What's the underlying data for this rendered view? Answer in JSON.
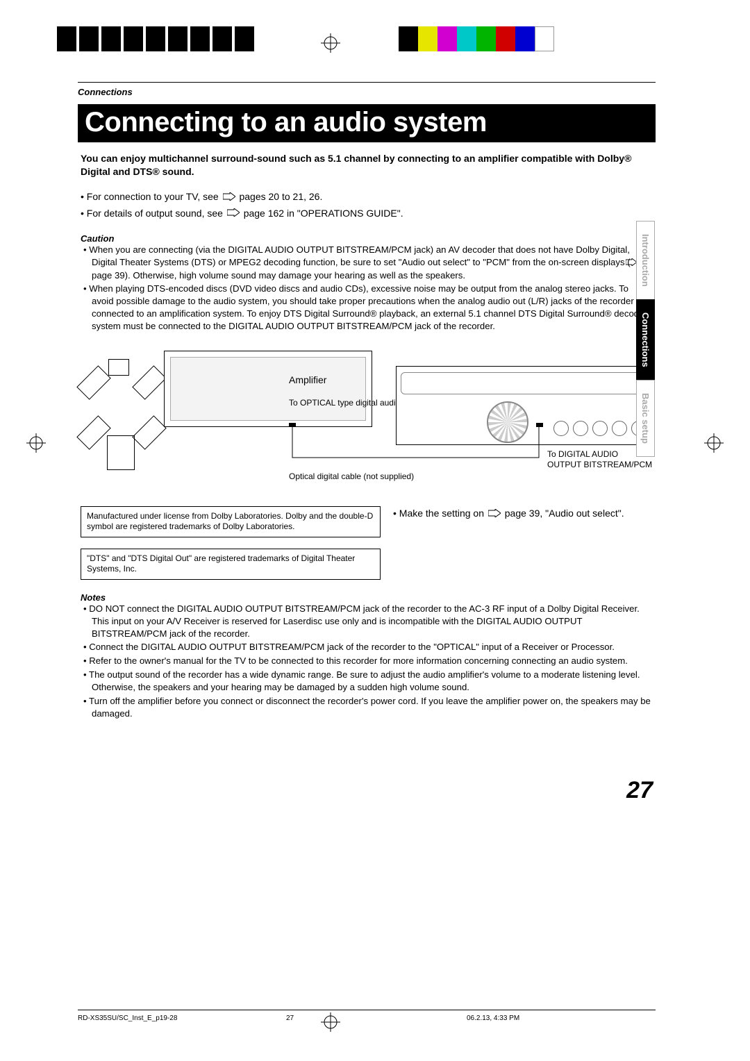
{
  "header": {
    "section_label": "Connections",
    "title": "Connecting to an audio system"
  },
  "intro": "You can enjoy multichannel surround-sound such as 5.1 channel by connecting to an amplifier compatible with Dolby® Digital and DTS® sound.",
  "bullets": {
    "tv_prefix": "• For connection to your TV, see ",
    "tv_suffix": " pages 20 to 21, 26.",
    "sound_prefix": "• For details of output sound, see ",
    "sound_suffix": " page 162 in \"OPERATIONS GUIDE\"."
  },
  "caution": {
    "heading": "Caution",
    "item1a": "• When you are connecting (via the DIGITAL AUDIO OUTPUT BITSTREAM/PCM jack) an AV decoder that does not have Dolby Digital, Digital Theater Systems (DTS) or MPEG2 decoding function, be sure to set \"Audio out select\" to \"PCM\" from the on-screen displays (",
    "item1b": " page 39). Otherwise, high volume sound may damage your hearing as well as the speakers.",
    "item2": "• When playing DTS-encoded discs (DVD video discs and audio CDs), excessive noise may be output from the analog stereo jacks. To avoid possible damage to the audio system, you should take proper precautions when the analog audio out (L/R) jacks of the recorder are connected to an amplification system.  To enjoy DTS Digital Surround® playback, an external 5.1 channel DTS Digital Surround® decoder system must be connected to the DIGITAL AUDIO OUTPUT BITSTREAM/PCM jack of the recorder."
  },
  "diagram": {
    "amplifier": "Amplifier",
    "to_optical": "To OPTICAL type digital audio input",
    "cable_note": "Optical digital cable (not supplied)",
    "to_output": "To DIGITAL AUDIO OUTPUT BITSTREAM/PCM"
  },
  "licenses": {
    "dolby": "Manufactured under license from Dolby Laboratories.  Dolby and the double-D symbol are registered trademarks of Dolby Laboratories.",
    "dts": "\"DTS\" and \"DTS Digital Out\" are registered trademarks of Digital Theater Systems, Inc."
  },
  "setting_note_prefix": "• Make the setting on ",
  "setting_note_suffix": " page 39, \"Audio out select\".",
  "notes": {
    "heading": "Notes",
    "n1": "• DO NOT connect the DIGITAL AUDIO OUTPUT BITSTREAM/PCM jack of the recorder to the AC-3 RF input of a Dolby Digital Receiver.  This input on your A/V Receiver is reserved for Laserdisc use only and is incompatible with the DIGITAL AUDIO OUTPUT BITSTREAM/PCM jack of the recorder.",
    "n2": "• Connect the DIGITAL AUDIO OUTPUT BITSTREAM/PCM jack of the recorder to the \"OPTICAL\" input of a Receiver or Processor.",
    "n3": "• Refer to the owner's manual for the TV to be connected to this recorder for more information concerning connecting an audio system.",
    "n4": "• The output sound of the recorder has a wide dynamic range. Be sure to adjust the audio amplifier's volume to a moderate listening level. Otherwise, the speakers and your hearing may be damaged by a sudden high volume sound.",
    "n5": "• Turn off the amplifier before you connect or disconnect the recorder's power cord. If you leave the amplifier power on, the speakers may be damaged."
  },
  "side_tabs": {
    "intro": "Introduction",
    "connections": "Connections",
    "basic": "Basic setup"
  },
  "page_number": "27",
  "footer": {
    "file": "RD-XS35SU/SC_Inst_E_p19-28",
    "page": "27",
    "date": "06.2.13, 4:33 PM"
  },
  "colors": [
    "#000000",
    "#e5e500",
    "#d100d1",
    "#00c8c8",
    "#00b400",
    "#d10000",
    "#0000d1",
    "#ffffff"
  ]
}
